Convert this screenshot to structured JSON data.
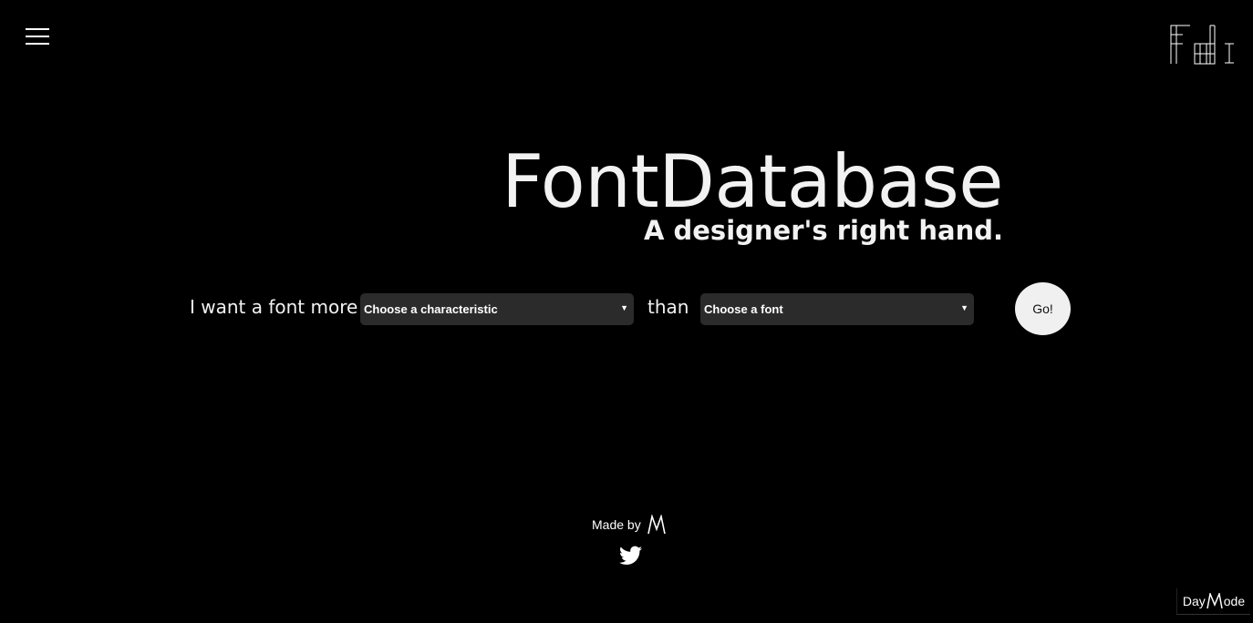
{
  "header": {
    "menu_icon": "hamburger-menu-icon",
    "logo_icon": "fontdatabase-logo-icon"
  },
  "hero": {
    "title": "FontDatabase",
    "subtitle": "A designer's right hand."
  },
  "search": {
    "prefix_label": "I want a font more",
    "characteristic_select": "Choose a characteristic",
    "connector_label": "than",
    "font_select": "Choose a font",
    "go_label": "Go!"
  },
  "footer": {
    "made_by": "Made by",
    "author_logo_icon": "author-m-logo-icon",
    "twitter_icon": "twitter-icon"
  },
  "mode_toggle": {
    "before": "Day",
    "after": "ode"
  },
  "colors": {
    "background": "#000000",
    "text": "#f2f2f2",
    "select_bg": "#2b2b2b",
    "button_bg": "#f0f0f0"
  }
}
